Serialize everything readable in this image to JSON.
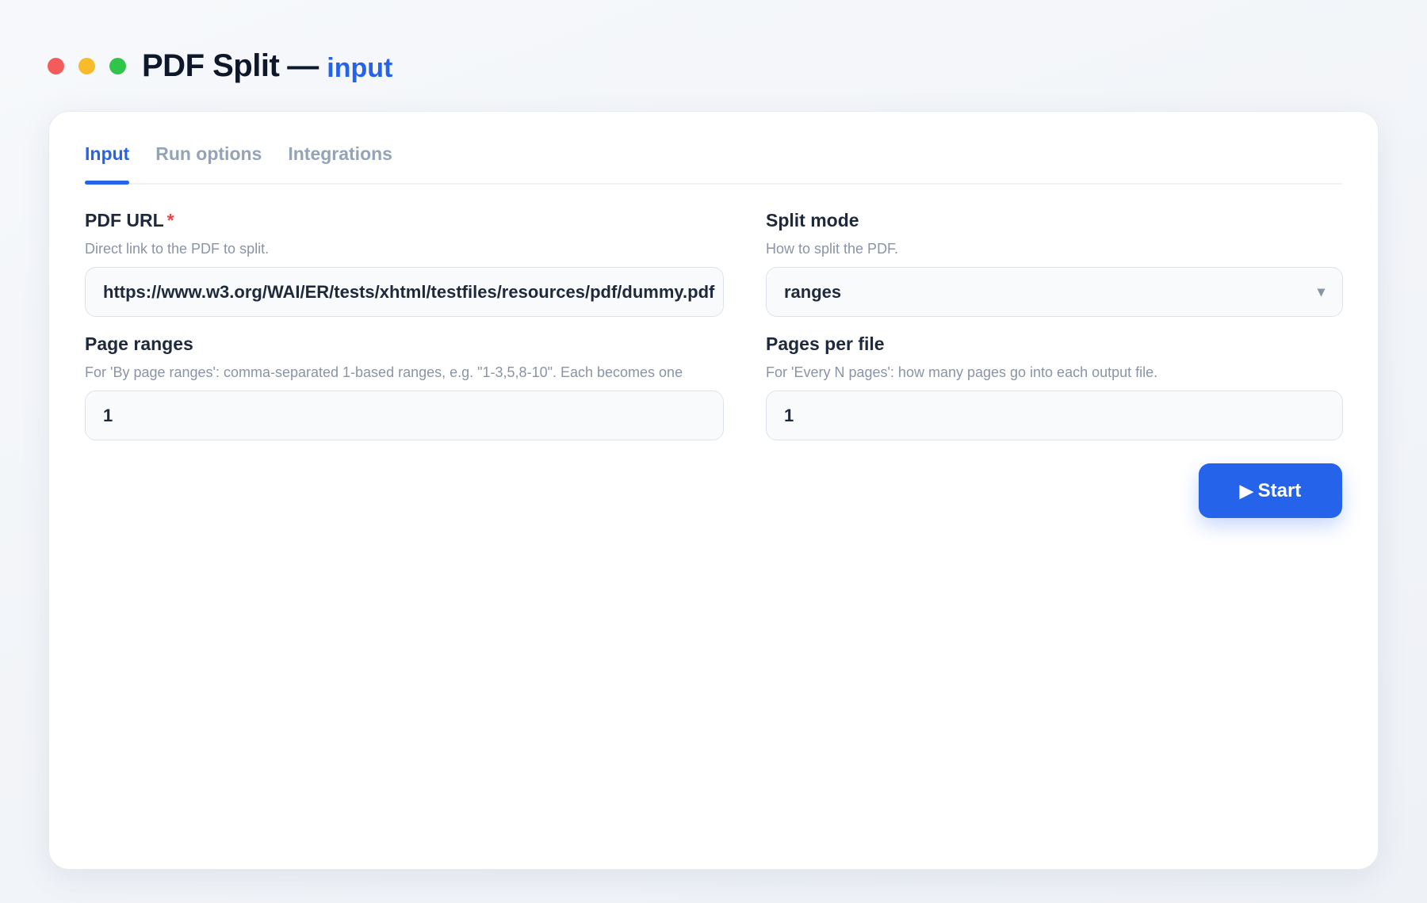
{
  "window": {
    "title": "PDF Split",
    "separator": "—",
    "subtitle": "input"
  },
  "tabs": [
    {
      "label": "Input",
      "active": true
    },
    {
      "label": "Run options",
      "active": false
    },
    {
      "label": "Integrations",
      "active": false
    }
  ],
  "fields": {
    "pdf_url": {
      "label": "PDF URL",
      "required_mark": "*",
      "help": "Direct link to the PDF to split.",
      "value": "https://www.w3.org/WAI/ER/tests/xhtml/testfiles/resources/pdf/dummy.pdf"
    },
    "split_mode": {
      "label": "Split mode",
      "help": "How to split the PDF.",
      "value": "ranges",
      "caret_icon": "▾"
    },
    "page_ranges": {
      "label": "Page ranges",
      "help": "For 'By page ranges': comma-separated 1-based ranges, e.g. \"1-3,5,8-10\". Each becomes one",
      "value": "1"
    },
    "pages_per_file": {
      "label": "Pages per file",
      "help": "For 'Every N pages': how many pages go into each output file.",
      "value": "1"
    }
  },
  "actions": {
    "start_icon": "▶",
    "start_label": "Start"
  },
  "colors": {
    "accent": "#2563eb",
    "required": "#ef4444",
    "traffic_red": "#f45b5b",
    "traffic_yellow": "#f7bb2c",
    "traffic_green": "#2fc54a"
  }
}
